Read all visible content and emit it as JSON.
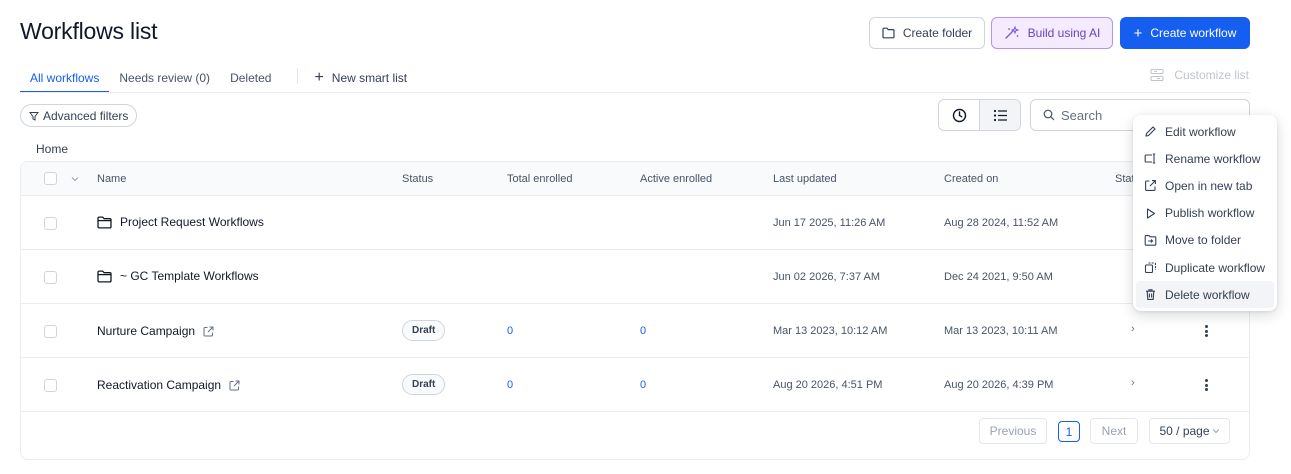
{
  "page": {
    "title": "Workflows list"
  },
  "header": {
    "create_folder_label": "Create folder",
    "build_ai_label": "Build using AI",
    "create_workflow_label": "Create workflow"
  },
  "tabs": [
    {
      "label": "All workflows",
      "active": true
    },
    {
      "label": "Needs review (0)",
      "active": false
    },
    {
      "label": "Deleted",
      "active": false
    }
  ],
  "new_smart_list_label": "New smart list",
  "customize_list_label": "Customize list",
  "filters": {
    "advanced_filters_label": "Advanced filters"
  },
  "search": {
    "placeholder": "Search",
    "value": ""
  },
  "breadcrumb": "Home",
  "table": {
    "columns": [
      "Name",
      "Status",
      "Total enrolled",
      "Active enrolled",
      "Last updated",
      "Created on",
      "Stat"
    ],
    "rows": [
      {
        "type": "folder",
        "name": "Project Request Workflows",
        "status": "",
        "total": "",
        "active": "",
        "updated": "Jun 17 2025, 11:26 AM",
        "created": "Aug 28 2024, 11:52 AM"
      },
      {
        "type": "folder",
        "name": "~ GC Template Workflows",
        "status": "",
        "total": "",
        "active": "",
        "updated": "Jun 02 2026, 7:37 AM",
        "created": "Dec 24 2021, 9:50 AM"
      },
      {
        "type": "workflow",
        "name": "Nurture Campaign",
        "status": "Draft",
        "total": "0",
        "active": "0",
        "updated": "Mar 13 2023, 10:12 AM",
        "created": "Mar 13 2023, 10:11 AM",
        "stats_chevron": "›"
      },
      {
        "type": "workflow",
        "name": "Reactivation Campaign",
        "status": "Draft",
        "total": "0",
        "active": "0",
        "updated": "Aug 20 2026, 4:51 PM",
        "created": "Aug 20 2026, 4:39 PM",
        "stats_chevron": "›"
      }
    ]
  },
  "pagination": {
    "previous_label": "Previous",
    "current_page": "1",
    "next_label": "Next",
    "per_page": "50 / page"
  },
  "context_menu": {
    "items": [
      {
        "label": "Edit workflow",
        "icon": "pencil-icon"
      },
      {
        "label": "Rename workflow",
        "icon": "rename-icon"
      },
      {
        "label": "Open in new tab",
        "icon": "external-link-icon"
      },
      {
        "label": "Publish workflow",
        "icon": "play-icon"
      },
      {
        "label": "Move to folder",
        "icon": "folder-move-icon"
      },
      {
        "label": "Duplicate workflow",
        "icon": "duplicate-icon"
      },
      {
        "label": "Delete workflow",
        "icon": "trash-icon",
        "hovered": true
      }
    ]
  },
  "colors": {
    "primary": "#155eef",
    "ai_bg": "#f4ebff",
    "ai_text": "#6941c6",
    "border": "#d0d5dd"
  }
}
